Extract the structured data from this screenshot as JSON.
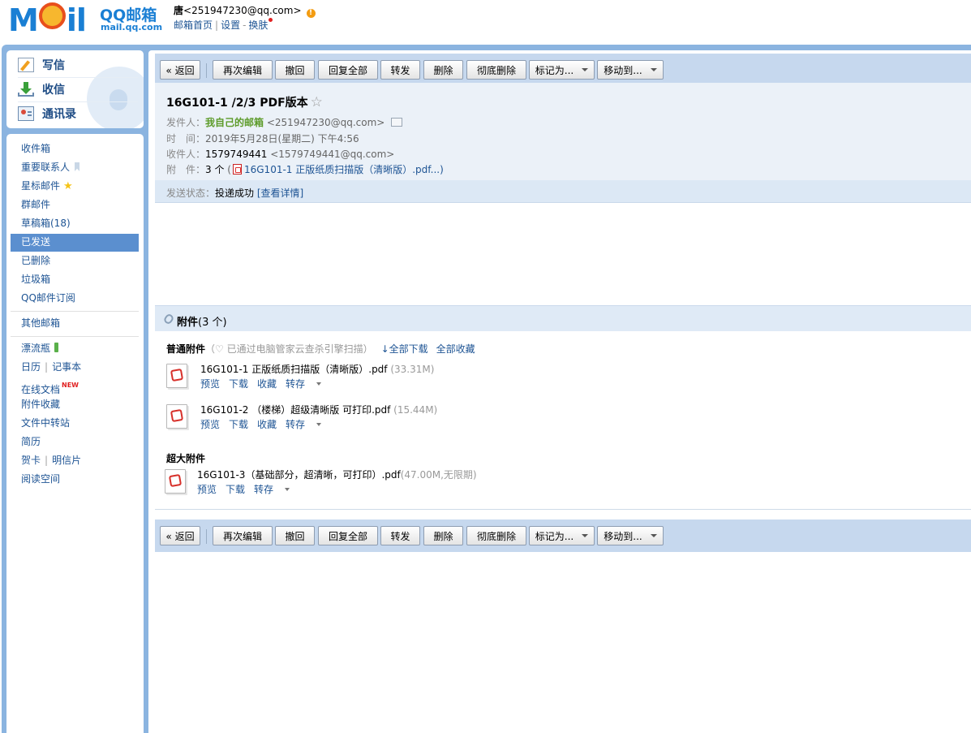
{
  "header": {
    "logo_text": "MOil",
    "logo_brand": "QQ邮箱",
    "logo_url": "mail.qq.com",
    "user_name": "唐",
    "user_email": "<251947230@qq.com>",
    "nav_home": "邮箱首页",
    "nav_sep": "|",
    "nav_settings": "设置",
    "nav_dash": "-",
    "nav_skin": "换肤"
  },
  "sidebar": {
    "compose": "写信",
    "inbox_main": "收信",
    "contacts": "通讯录",
    "folders": {
      "inbox": "收件箱",
      "vip": "重要联系人",
      "starred": "星标邮件",
      "group": "群邮件",
      "drafts": "草稿箱(18)",
      "sent": "已发送",
      "deleted": "已删除",
      "spam": "垃圾箱",
      "subscribe": "QQ邮件订阅",
      "other_mailbox": "其他邮箱",
      "bottle": "漂流瓶",
      "calendar": "日历",
      "sep": "|",
      "notes": "记事本",
      "docs": "在线文档",
      "docs_badge": "NEW",
      "att_fav": "附件收藏",
      "transfer": "文件中转站",
      "resume": "简历",
      "card": "贺卡",
      "postcard": "明信片",
      "reading": "阅读空间"
    }
  },
  "toolbar": {
    "back": "« 返回",
    "reedit": "再次编辑",
    "recall": "撤回",
    "reply_all": "回复全部",
    "forward": "转发",
    "delete": "删除",
    "delete_forever": "彻底删除",
    "mark_as": "标记为...",
    "move_to": "移动到..."
  },
  "mail": {
    "subject": "16G101-1 /2/3 PDF版本",
    "star": "☆",
    "from_label": "发件人：",
    "from_name": "我自己的邮箱",
    "from_email": "<251947230@qq.com>",
    "time_label": "时　间：",
    "time_value": "2019年5月28日(星期二) 下午4:56",
    "to_label": "收件人：",
    "to_name": "1579749441",
    "to_email": "<1579749441@qq.com>",
    "att_label": "附　件：",
    "att_count": "3 个",
    "att_preview": "(",
    "att_preview_name": "16G101-1 正版纸质扫描版（清晰版）.pdf...)",
    "status_label": "发送状态：",
    "status_value": "投递成功",
    "status_link": "[查看详情]"
  },
  "attachments": {
    "title_bold": "附件",
    "title_count": "(3 个)",
    "normal_label": "普通附件",
    "normal_note": "（♡ 已通过电脑管家云查杀引擎扫描）",
    "download_all": "↓全部下载",
    "fav_all": "全部收藏",
    "big_label": "超大附件",
    "files": [
      {
        "name": "16G101-1 正版纸质扫描版（清晰版）.pdf ",
        "size": "(33.31M)",
        "preview": "预览",
        "download": "下载",
        "fav": "收藏",
        "save": "转存"
      },
      {
        "name": "16G101-2 （楼梯）超级清晰版 可打印.pdf ",
        "size": "(15.44M)",
        "preview": "预览",
        "download": "下载",
        "fav": "收藏",
        "save": "转存"
      },
      {
        "name": "16G101-3（基础部分，超清晰，可打印）.pdf",
        "size": "(47.00M,无限期)",
        "preview": "预览",
        "download": "下载",
        "save": "转存"
      }
    ]
  }
}
